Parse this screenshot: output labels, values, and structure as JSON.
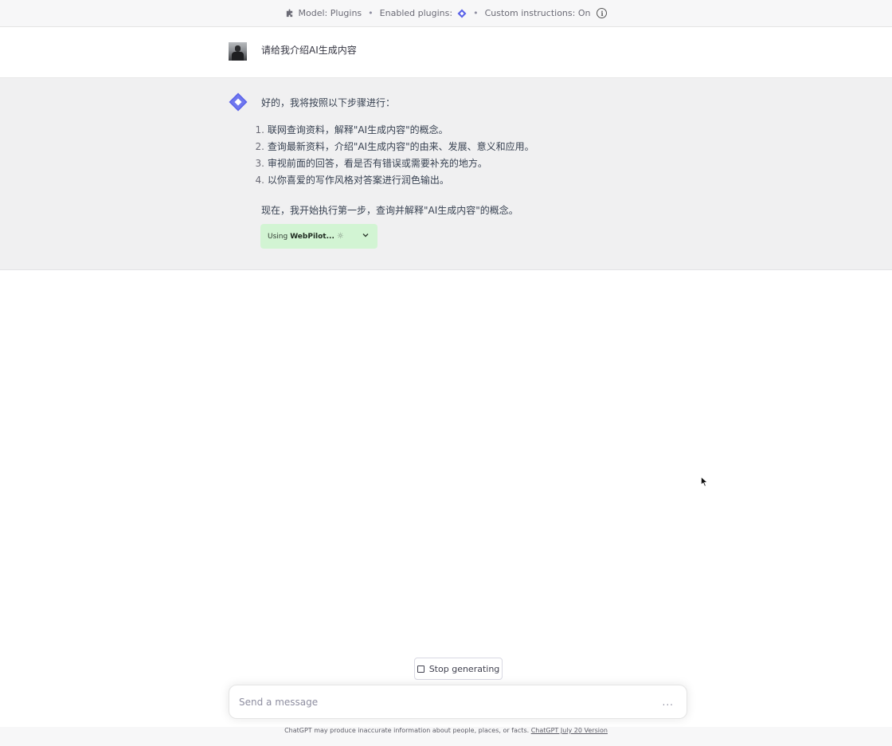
{
  "topbar": {
    "model_text": "Model: Plugins",
    "enabled_text": "Enabled plugins:",
    "custom_text": "Custom instructions: On",
    "separator": "•"
  },
  "user_message": {
    "text": "请给我介绍AI生成内容"
  },
  "assistant_message": {
    "intro": "好的，我将按照以下步骤进行：",
    "steps": [
      {
        "num": "1.",
        "text": "联网查询资料，解释\"AI生成内容\"的概念。"
      },
      {
        "num": "2.",
        "text": "查询最新资料，介绍\"AI生成内容\"的由来、发展、意义和应用。"
      },
      {
        "num": "3.",
        "text": "审视前面的回答，看是否有错误或需要补充的地方。"
      },
      {
        "num": "4.",
        "text": "以你喜爱的写作风格对答案进行润色输出。"
      }
    ],
    "now": "现在，我开始执行第一步，查询并解释\"AI生成内容\"的概念。",
    "plugin_status": {
      "prefix": "Using",
      "name": "WebPilot...",
      "spinner": "☼"
    }
  },
  "stop_button": {
    "label": "Stop generating"
  },
  "composer": {
    "placeholder": "Send a message",
    "dots": "..."
  },
  "footer": {
    "text": "ChatGPT may produce inaccurate information about people, places, or facts.",
    "link": "ChatGPT July 20 Version"
  },
  "colors": {
    "plugin_bg": "#d2f4d3",
    "assistant_bg": "#f0f0f1",
    "plugin_icon": "#5b63e8"
  },
  "icons": {
    "plugins_model": "plugins-puzzle-icon",
    "plugin": "webpilot-icon",
    "info": "info-icon",
    "chevron": "chevron-down-icon",
    "stop": "stop-square-icon"
  }
}
